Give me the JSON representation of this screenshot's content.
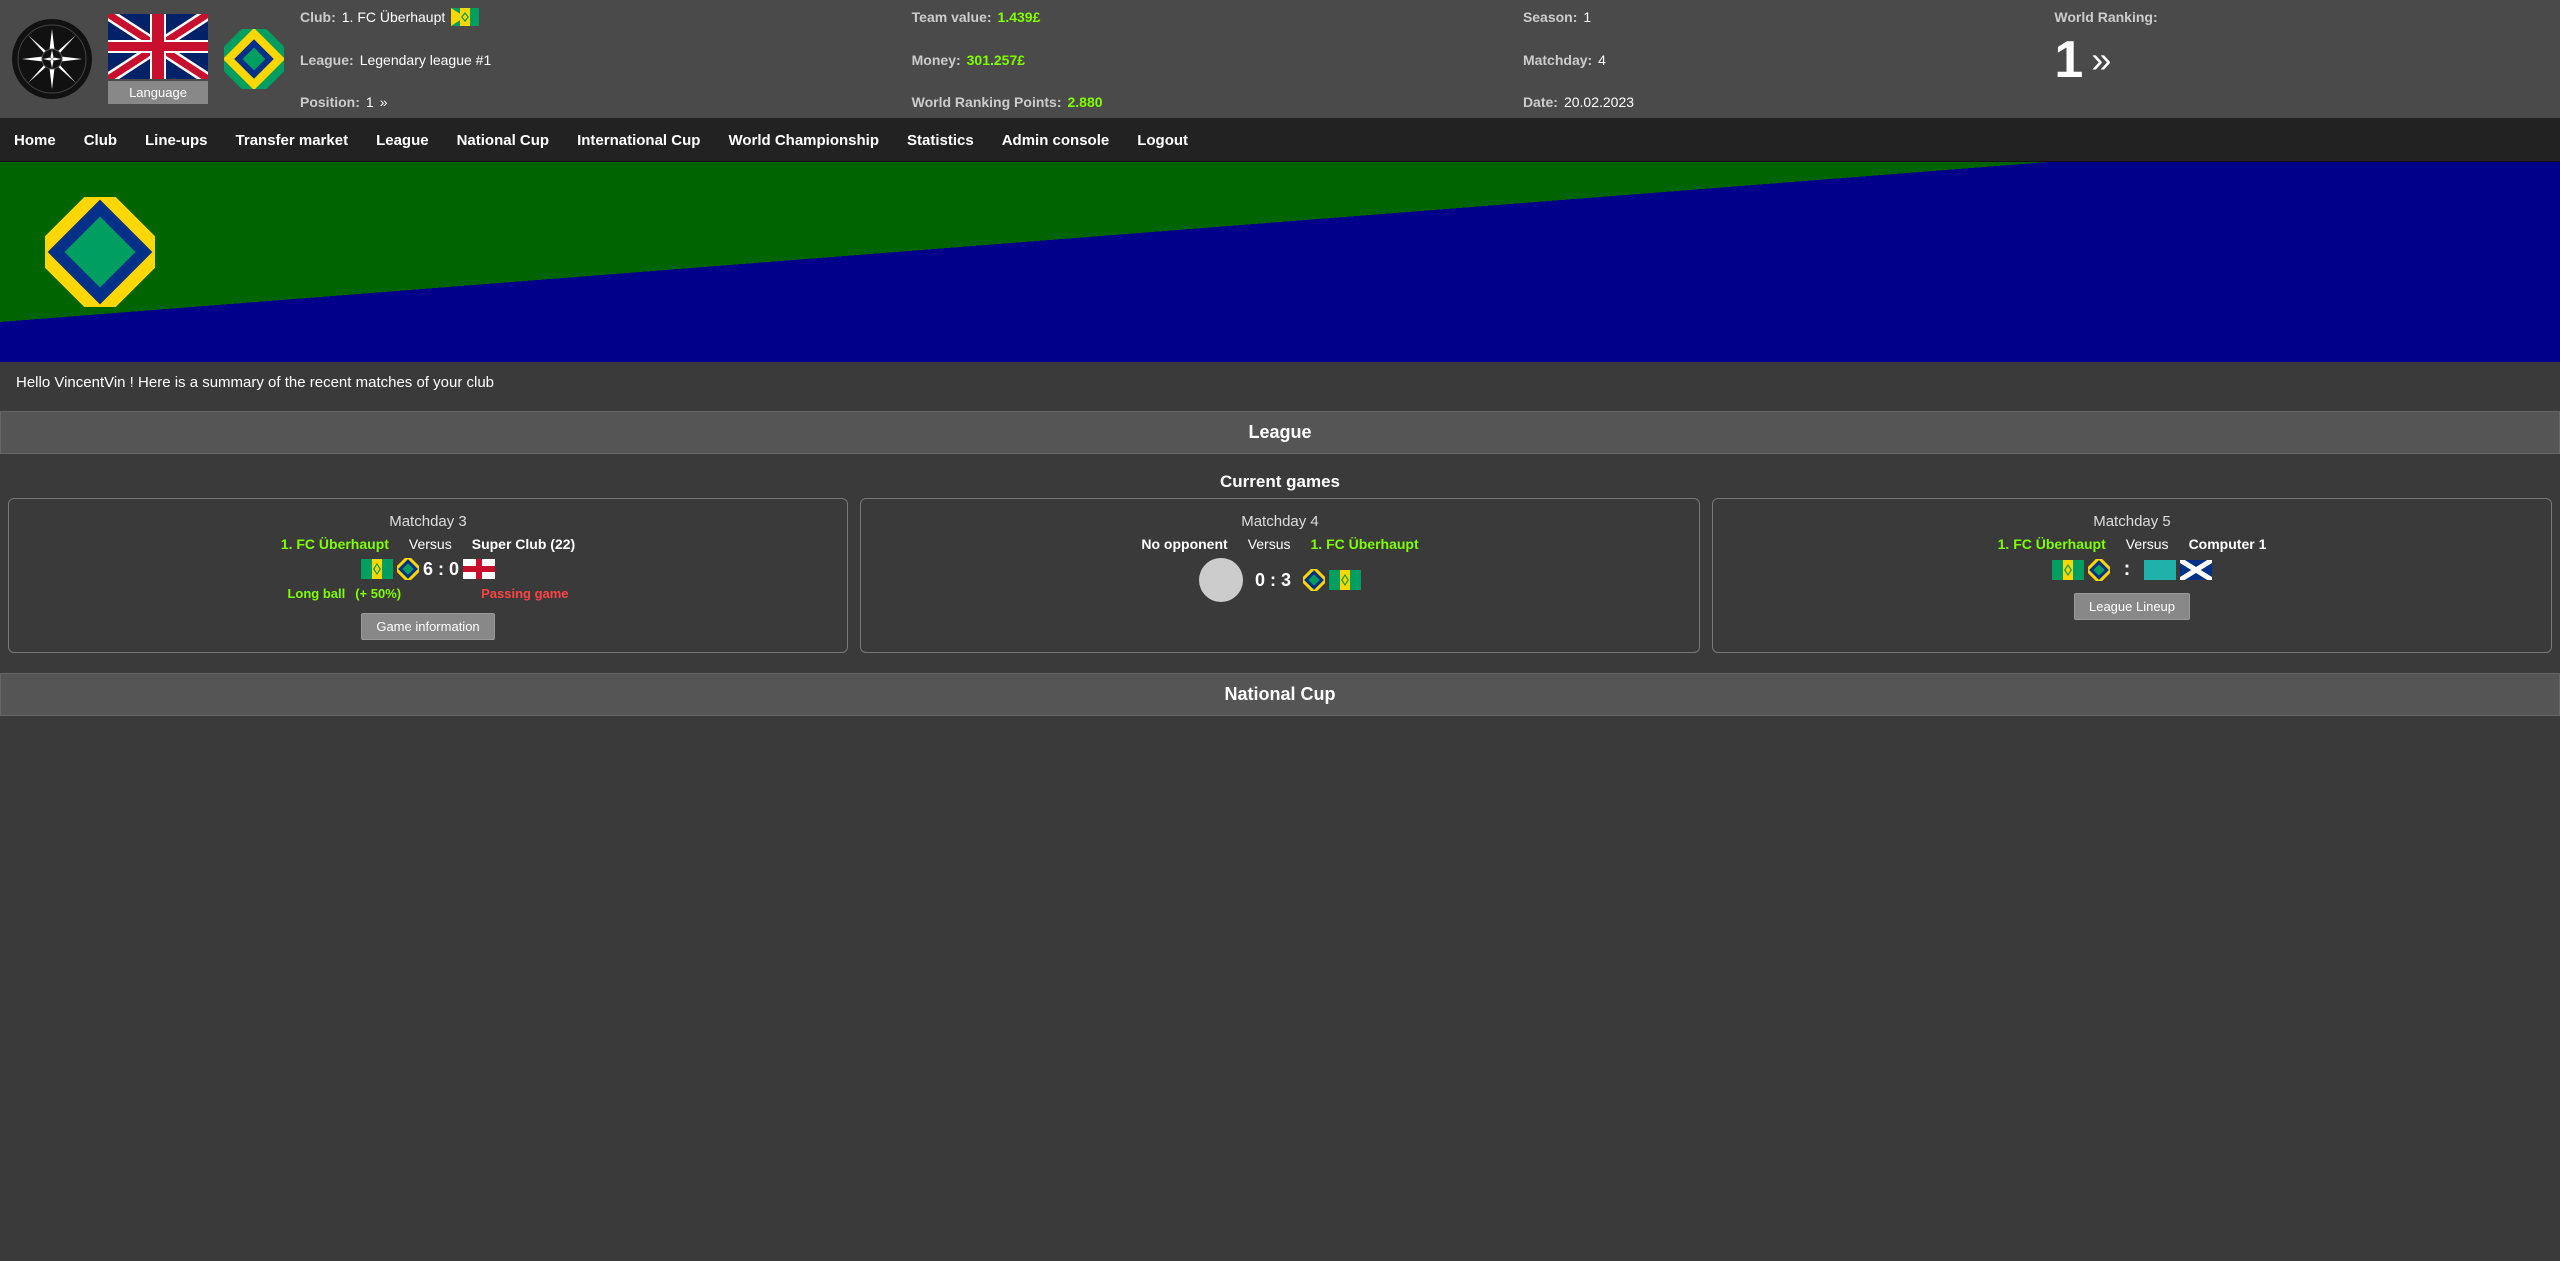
{
  "header": {
    "club_label": "Club:",
    "club_value": "1. FC Überhaupt",
    "team_value_label": "Team value:",
    "team_value": "1.439£",
    "season_label": "Season:",
    "season_value": "1",
    "world_ranking_label": "World Ranking:",
    "world_ranking_value": "1",
    "league_label": "League:",
    "league_value": "Legendary league #1",
    "money_label": "Money:",
    "money_value": "301.257£",
    "matchday_label": "Matchday:",
    "matchday_value": "4",
    "position_label": "Position:",
    "position_value": "1",
    "position_arrows": "»",
    "world_ranking_points_label": "World Ranking Points:",
    "world_ranking_points_value": "2.880",
    "date_label": "Date:",
    "date_value": "20.02.2023",
    "language_btn": "Language"
  },
  "nav": {
    "items": [
      "Home",
      "Club",
      "Line-ups",
      "Transfer market",
      "League",
      "National Cup",
      "International Cup",
      "World Championship",
      "Statistics",
      "Admin console",
      "Logout"
    ]
  },
  "welcome": {
    "text": "Hello VincentVin ! Here is a summary of the recent matches of your club"
  },
  "league_section": {
    "title": "League",
    "current_games_title": "Current games",
    "games": [
      {
        "matchday": "Matchday 3",
        "team1": "1. FC Überhaupt",
        "versus": "Versus",
        "team2": "Super Club (22)",
        "score": "6 : 0",
        "tactic1": "Long ball",
        "tactic1_bonus": "(+ 50%)",
        "tactic2": "Passing game",
        "has_result": true,
        "btn_label": "Game information"
      },
      {
        "matchday": "Matchday 4",
        "team1": "No opponent",
        "versus": "Versus",
        "team2": "1. FC Überhaupt",
        "score": "0 : 3",
        "has_result": true,
        "no_opponent": true
      },
      {
        "matchday": "Matchday 5",
        "team1": "1. FC Überhaupt",
        "versus": "Versus",
        "team2": "Computer 1",
        "score": ":",
        "has_result": false,
        "btn_label": "League Lineup"
      }
    ]
  },
  "national_cup_section": {
    "title": "National Cup"
  }
}
